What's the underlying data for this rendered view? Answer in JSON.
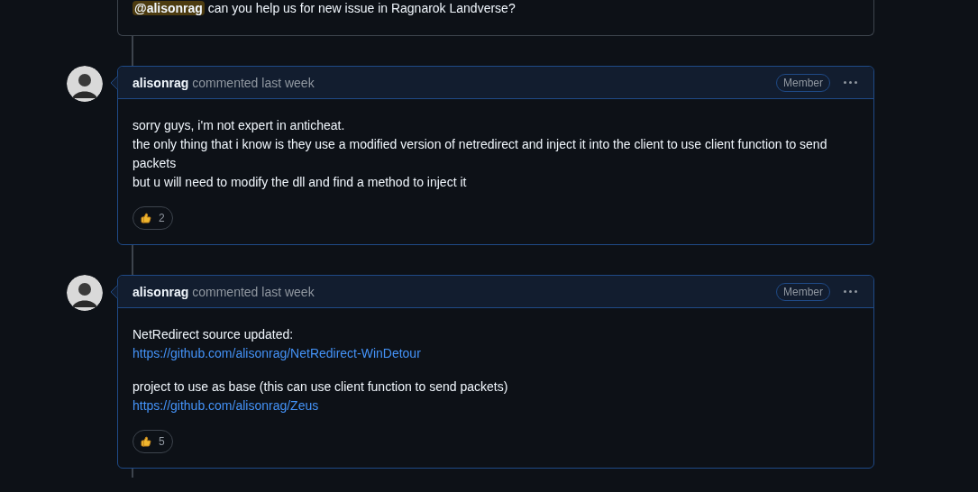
{
  "partial_comment": {
    "mention": "@alisonrag",
    "text": "can you help us for new issue in Ragnarok Landverse?"
  },
  "comments": [
    {
      "author": "alisonrag",
      "action": "commented last week",
      "badge": "Member",
      "paragraphs": [
        [
          {
            "kind": "text",
            "text": "sorry guys, i'm not expert in anticheat."
          },
          {
            "kind": "text",
            "text": "the only thing that i know is they use a modified version of netredirect and inject it into the client to use client function to send packets"
          },
          {
            "kind": "text",
            "text": "but u will need to modify the dll and find a method to inject it"
          }
        ]
      ],
      "reaction_count": "2"
    },
    {
      "author": "alisonrag",
      "action": "commented last week",
      "badge": "Member",
      "paragraphs": [
        [
          {
            "kind": "text",
            "text": "NetRedirect source updated:"
          },
          {
            "kind": "link",
            "text": "https://github.com/alisonrag/NetRedirect-WinDetour"
          }
        ],
        [
          {
            "kind": "text",
            "text": "project to use as base (this can use client function to send packets)"
          },
          {
            "kind": "link",
            "text": "https://github.com/alisonrag/Zeus"
          }
        ]
      ],
      "reaction_count": "5"
    }
  ]
}
